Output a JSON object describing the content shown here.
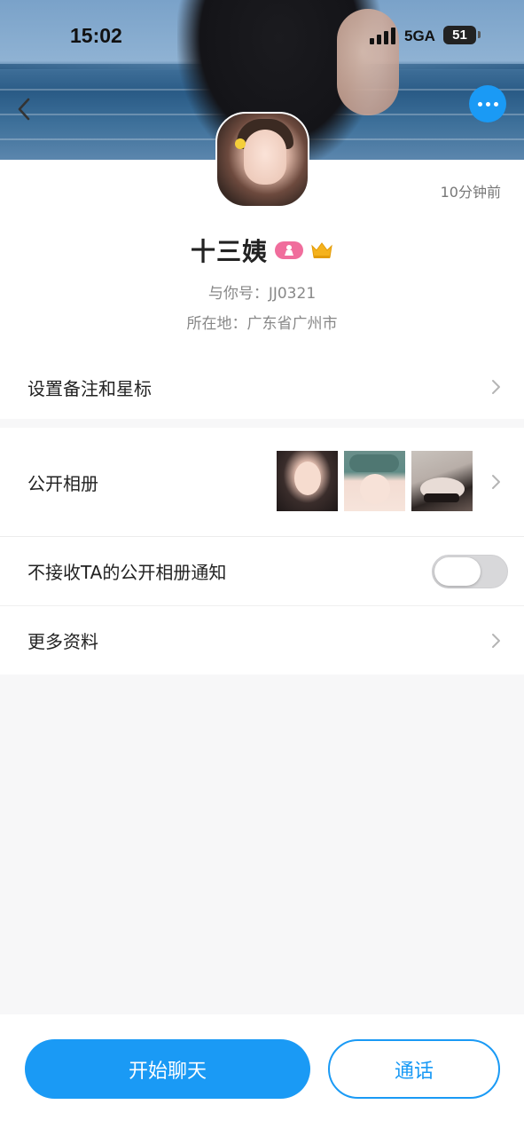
{
  "status_bar": {
    "time": "15:02",
    "network": "5GA",
    "battery": "51"
  },
  "profile": {
    "last_seen": "10分钟前",
    "name": "十三姨",
    "id_line": "与你号：JJ0321",
    "location_line": "所在地：广东省广州市",
    "gender_badge_color": "#f06d9c"
  },
  "menu": {
    "remark_label": "设置备注和星标",
    "album_label": "公开相册",
    "notify_label": "不接收TA的公开相册通知",
    "notify_enabled": false,
    "more_label": "更多资料"
  },
  "actions": {
    "chat_label": "开始聊天",
    "call_label": "通话"
  },
  "colors": {
    "accent": "#1a9af5",
    "crown": "#f5b21c"
  }
}
